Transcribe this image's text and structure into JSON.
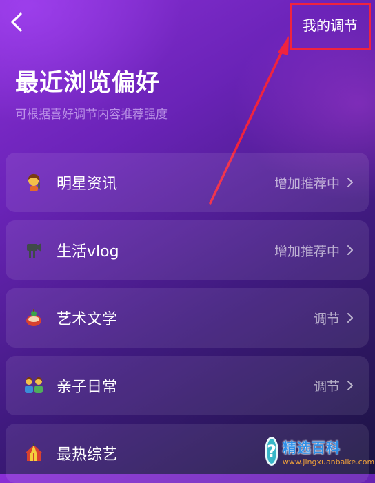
{
  "header": {
    "back_icon": "chevron-left-icon",
    "adjust_button_label": "我的调节"
  },
  "annotation": {
    "highlight_color": "#f0233e"
  },
  "main": {
    "title": "最近浏览偏好",
    "subtitle": "可根据喜好调节内容推荐强度",
    "items": [
      {
        "icon": "singer-emoji-icon",
        "label": "明星资讯",
        "status": "增加推荐中"
      },
      {
        "icon": "video-camera-icon",
        "label": "生活vlog",
        "status": "增加推荐中"
      },
      {
        "icon": "art-palette-icon",
        "label": "艺术文学",
        "status": "调节"
      },
      {
        "icon": "family-icon",
        "label": "亲子日常",
        "status": "调节"
      },
      {
        "icon": "circus-tent-icon",
        "label": "最热综艺",
        "status": ""
      }
    ]
  },
  "watermark": {
    "title": "精选百科",
    "url": "www.jingxuanbaike.com"
  }
}
